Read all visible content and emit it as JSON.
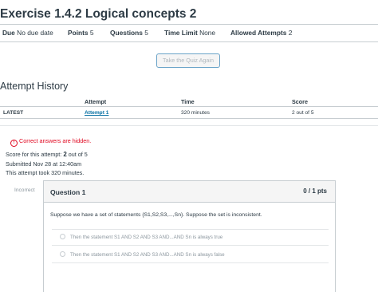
{
  "page_title": "Exercise 1.4.2 Logical concepts 2",
  "meta": {
    "due_label": "Due",
    "due_value": "No due date",
    "points_label": "Points",
    "points_value": "5",
    "questions_label": "Questions",
    "questions_value": "5",
    "time_limit_label": "Time Limit",
    "time_limit_value": "None",
    "attempts_label": "Allowed Attempts",
    "attempts_value": "2"
  },
  "retake_button": "Take the Quiz Again",
  "attempt_history": {
    "heading": "Attempt History",
    "columns": [
      "Attempt",
      "Time",
      "Score"
    ],
    "rows": [
      {
        "label": "LATEST",
        "attempt": "Attempt 1",
        "time": "320 minutes",
        "score": "2 out of 5"
      }
    ]
  },
  "alert": {
    "icon": "warning-circle-icon",
    "text": "Correct answers are hidden."
  },
  "summary": {
    "score_prefix": "Score for this attempt:",
    "score_value": "2",
    "score_suffix": "out of 5",
    "submitted": "Submitted Nov 28 at 12:40am",
    "duration": "This attempt took 320 minutes."
  },
  "question": {
    "status": "Incorrect",
    "title": "Question 1",
    "points": "0 / 1 pts",
    "text": "Suppose we have a set of statements {S1,S2,S3,...,Sn}. Suppose the set is inconsistent.",
    "answers": [
      "Then the statement S1 AND S2 AND S3 AND...AND Sn is always true",
      "Then the statement S1 AND S2 AND S3 AND...AND Sn is always false"
    ]
  },
  "colors": {
    "text": "#2d3b45",
    "link": "#0770a3",
    "alert": "#e0061f",
    "muted": "#8b969e",
    "border": "#c7cdd1"
  }
}
